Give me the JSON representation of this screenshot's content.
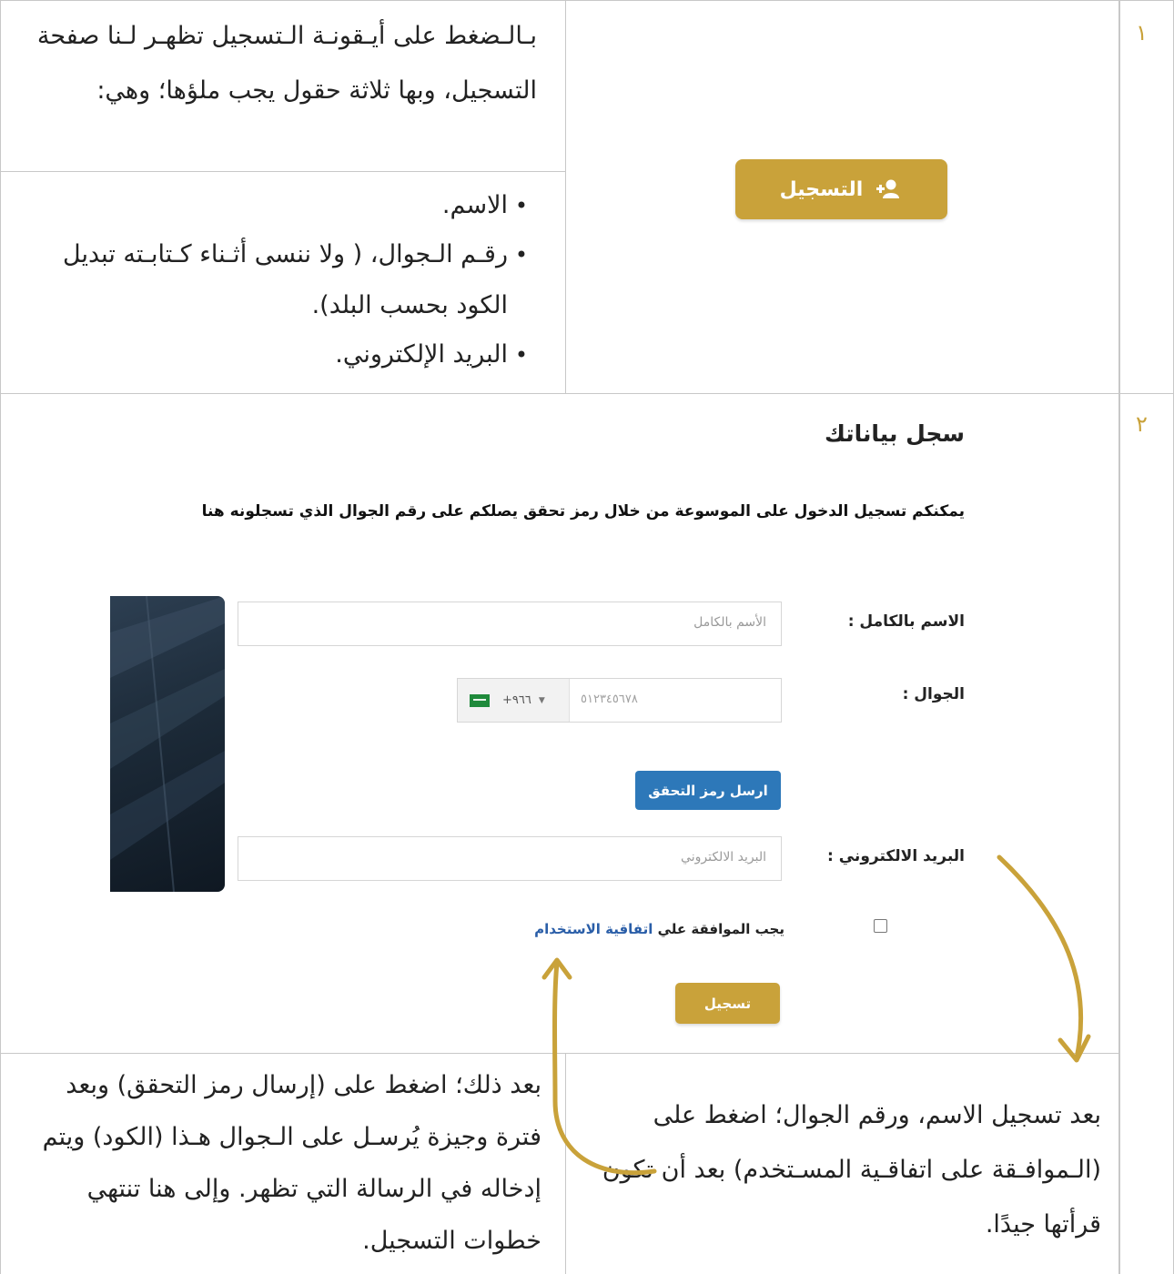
{
  "row1": {
    "number": "١",
    "intro_text": "بـالـضغط على أيـقونـة الـتسجيل تظهـر لـنا صفحة التسجيل، وبها ثلاثة حقول يجب ملؤها؛ وهي:",
    "bullets": [
      "الاسم.",
      "رقـم الـجوال، ( ولا ننسى أثـناء كـتابـته تبديل الكود بحسب البلد).",
      "البريد الإلكتروني."
    ],
    "register_button_label": "التسجيل"
  },
  "row2": {
    "number": "٢",
    "screenshot": {
      "heading": "سجل بياناتك",
      "subheading": "يمكنكم تسجيل الدخول على الموسوعة من خلال رمز تحقق يصلكم على رقم الجوال الذي تسجلونه هنا",
      "name_label": "الاسم بالكامل :",
      "name_placeholder": "الأسم بالكامل",
      "phone_label": "الجوال :",
      "phone_code": "+٩٦٦",
      "phone_placeholder": "٥١٢٣٤٥٦٧٨",
      "send_code_button": "ارسل رمز التحقق",
      "email_label": "البريد الالكتروني :",
      "email_placeholder": "البريد الالكتروني",
      "agree_text": "يجب الموافقة علي",
      "agree_link": "اتفاقية الاستخدام",
      "submit_button": "تسجيل"
    },
    "note_left": "بعد ذلك؛ اضغط على (إرسال رمز التحقق) وبعد فترة وجيزة يُرسـل على الـجوال هـذا (الكود) ويتم إدخاله في الرسالة التي تظهر. وإلى هنا تنتهي خطوات التسجيل.",
    "note_right": "بعد تسجيل الاسم، ورقم الجوال؛ اضغط على (الـموافـقة على اتفاقـية المسـتخدم) بعد أن تكون قرأتها جيدًا."
  },
  "colors": {
    "gold": "#c9a23a",
    "blue": "#2d78b9",
    "link": "#2a5ea8",
    "border": "#c8c8c8"
  },
  "icons": [
    "add-user-icon",
    "saudi-flag-icon",
    "dropdown-caret-icon",
    "arrow-down-icon",
    "arrow-up-icon"
  ]
}
